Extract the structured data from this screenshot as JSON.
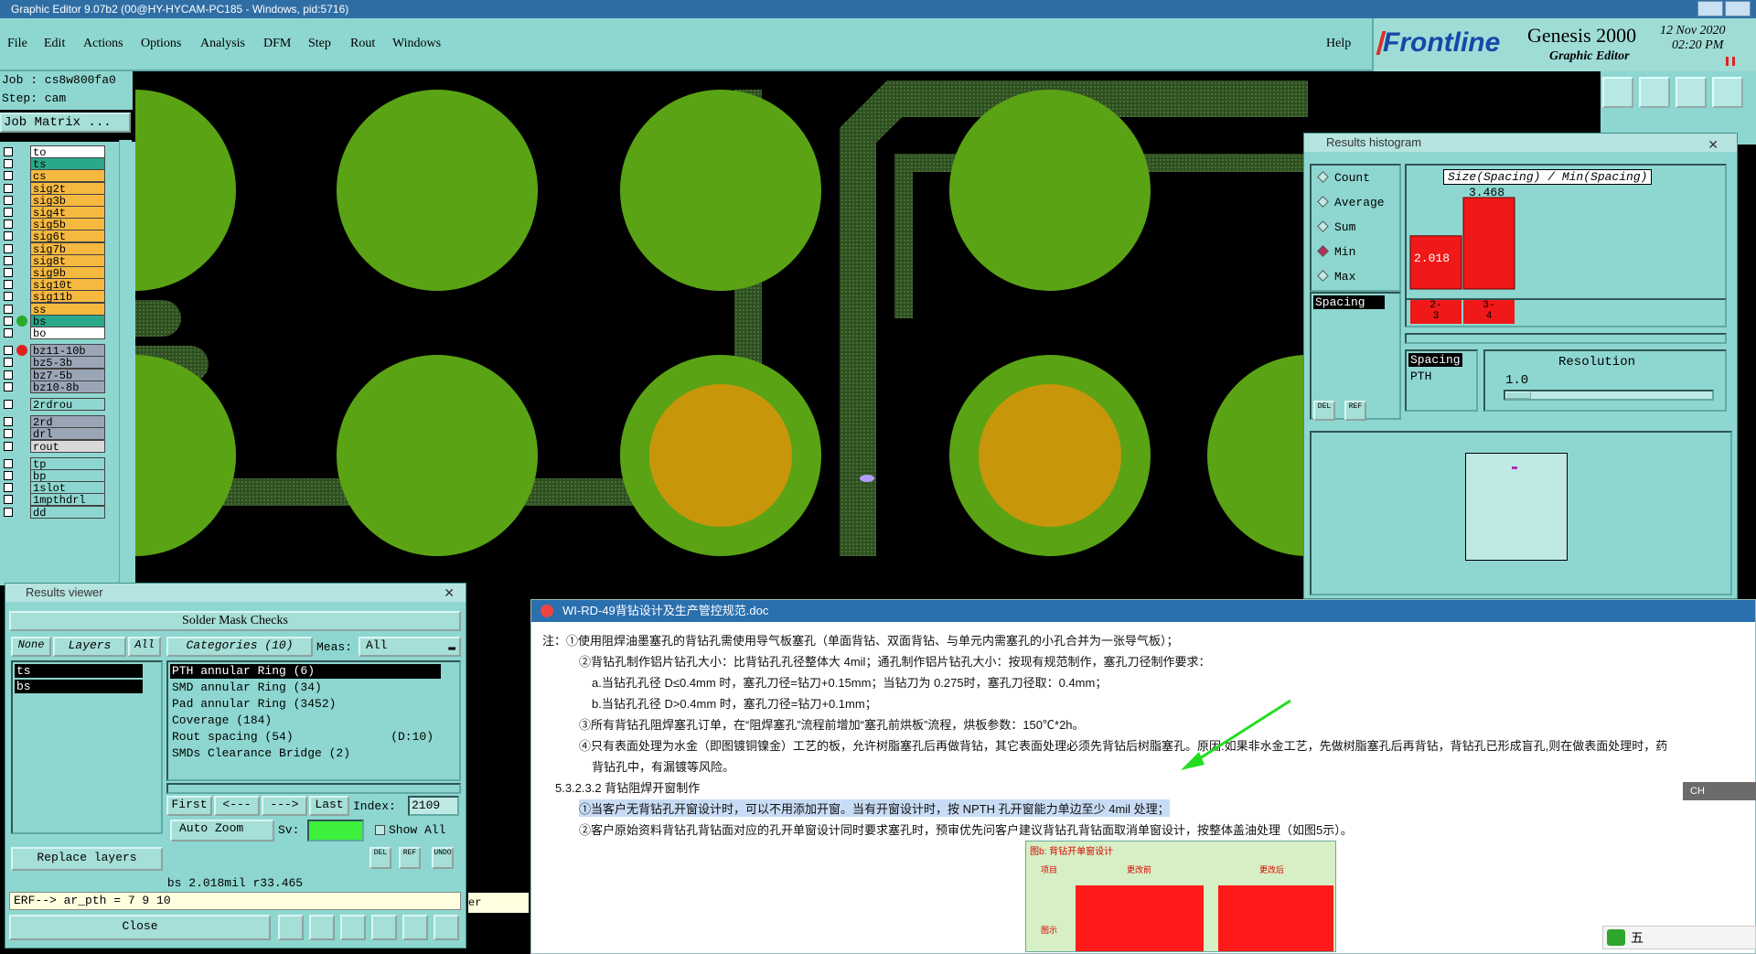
{
  "window": {
    "title": "Graphic Editor 9.07b2 (00@HY-HYCAM-PC185 - Windows, pid:5716)"
  },
  "menu": {
    "items": [
      "File",
      "Edit",
      "Actions",
      "Options",
      "Analysis",
      "DFM",
      "Step",
      "Rout",
      "Windows"
    ],
    "help": "Help"
  },
  "brand": {
    "logo": "Frontline",
    "product": "Genesis 2000",
    "subtitle": "Graphic Editor",
    "date": "12 Nov 2020",
    "time": "02:20 PM"
  },
  "job": {
    "job_line": "Job : cs8w800fa0",
    "step_line": "Step: cam",
    "matrix_button": "Job Matrix ..."
  },
  "layers": [
    {
      "name": "to",
      "color": "#ffffff"
    },
    {
      "name": "ts",
      "color": "#2aa88a"
    },
    {
      "name": "cs",
      "color": "#f6b940"
    },
    {
      "name": "sig2t",
      "color": "#f6b940"
    },
    {
      "name": "sig3b",
      "color": "#f6b940"
    },
    {
      "name": "sig4t",
      "color": "#f6b940"
    },
    {
      "name": "sig5b",
      "color": "#f6b940"
    },
    {
      "name": "sig6t",
      "color": "#f6b940"
    },
    {
      "name": "sig7b",
      "color": "#f6b940"
    },
    {
      "name": "sig8t",
      "color": "#f6b940"
    },
    {
      "name": "sig9b",
      "color": "#f6b940"
    },
    {
      "name": "sig10t",
      "color": "#f6b940"
    },
    {
      "name": "sig11b",
      "color": "#f6b940"
    },
    {
      "name": "ss",
      "color": "#f6b940"
    },
    {
      "name": "bs",
      "color": "#2aa88a"
    },
    {
      "name": "bo",
      "color": "#ffffff"
    },
    {
      "name": "bz11-10b",
      "color": "#9aa6b6"
    },
    {
      "name": "bz5-3b",
      "color": "#9aa6b6"
    },
    {
      "name": "bz7-5b",
      "color": "#9aa6b6"
    },
    {
      "name": "bz10-8b",
      "color": "#9aa6b6"
    },
    {
      "name": "2rdrou",
      "color": "#8ed7d0"
    },
    {
      "name": "2rd",
      "color": "#9aa6b6"
    },
    {
      "name": "drl",
      "color": "#9aa6b6"
    },
    {
      "name": "rout",
      "color": "#d9d9d9"
    },
    {
      "name": "tp",
      "color": "#8ed7d0"
    },
    {
      "name": "bp",
      "color": "#8ed7d0"
    },
    {
      "name": "1slot",
      "color": "#8ed7d0"
    },
    {
      "name": "1mpthdrl",
      "color": "#8ed7d0"
    },
    {
      "name": "dd",
      "color": "#8ed7d0"
    }
  ],
  "histogram": {
    "title": "Results histogram",
    "modes": [
      "Count",
      "Average",
      "Sum",
      "Min",
      "Max"
    ],
    "selected_mode": "Min",
    "measure_list_item": "Spacing",
    "chart_title": "Size(Spacing) / Min(Spacing)",
    "bars": [
      {
        "label": "2-\n3",
        "value": 2.018,
        "value_text": "2.018"
      },
      {
        "label": "3-\n4",
        "value": 3.468,
        "value_text": "3.468"
      }
    ],
    "spacing_label": "Spacing",
    "pth_label": "PTH",
    "resolution_label": "Resolution",
    "resolution_value": "1.0"
  },
  "results_viewer": {
    "title": "Results viewer",
    "heading": "Solder Mask Checks",
    "none_btn": "None",
    "layers_btn": "Layers",
    "all_btn": "All",
    "layer_items": [
      "ts",
      "bs"
    ],
    "categories_label": "Categories (10)",
    "meas_label": "Meas:",
    "meas_value": "All",
    "categories": [
      {
        "text": "PTH annular Ring (6)",
        "extra": ""
      },
      {
        "text": "SMD annular Ring (34)",
        "extra": ""
      },
      {
        "text": "Pad annular Ring (3452)",
        "extra": ""
      },
      {
        "text": "Coverage (184)",
        "extra": ""
      },
      {
        "text": "Rout spacing (54)",
        "extra": "(D:10)"
      },
      {
        "text": "SMDs Clearance Bridge (2)",
        "extra": ""
      }
    ],
    "first_btn": "First",
    "prev_btn": "<---",
    "next_btn": "--->",
    "last_btn": "Last",
    "index_label": "Index:",
    "index_value": "2109",
    "auto_zoom": "Auto Zoom",
    "sv_label": "Sv:",
    "show_all": "Show All",
    "replace_layers": "Replace layers",
    "status_line": "bs 2.018mil  r33.465",
    "erf_line": "ERF--> ar_pth = 7 9 10",
    "close_btn": "Close",
    "side_fragment": "er"
  },
  "document": {
    "title": "WI-RD-49背钻设计及生产管控规范.doc",
    "lines": [
      "注：①使用阻焊油墨塞孔的背钻孔需使用导气板塞孔（单面背钻、双面背钻、与单元内需塞孔的小孔合并为一张导气板）；",
      "②背钻孔制作铝片钻孔大小：比背钻孔孔径整体大 4mil；通孔制作铝片钻孔大小：按现有规范制作，塞孔刀径制作要求：",
      "a.当钻孔孔径 D≤0.4mm 时，塞孔刀径=钻刀+0.15mm；当钻刀为 0.275时，塞孔刀径取：0.4mm；",
      "b.当钻孔孔径 D>0.4mm 时，塞孔刀径=钻刀+0.1mm；",
      "③所有背钻孔阻焊塞孔订单，在“阻焊塞孔”流程前增加“塞孔前烘板”流程，烘板参数：150℃*2h。",
      "④只有表面处理为水金（即图镀铜镍金）工艺的板，允许树脂塞孔后再做背钻，其它表面处理必须先背钻后树脂塞孔。原因:如果非水金工艺，先做树脂塞孔后再背钻，背钻孔已形成盲孔,则在做表面处理时，药",
      "背钻孔中，有漏镀等风险。",
      "5.3.2.3.2 背钻阻焊开窗制作",
      "①当客户无背钻孔开窗设计时，可以不用添加开窗。当有开窗设计时，按 NPTH 孔开窗能力单边至少 4mil 处理；",
      "②客户原始资料背钻孔背钻面对应的孔开单窗设计同时要求塞孔时，预审优先问客户建议背钻孔背钻面取消单窗设计，按整体盖油处理（如图5示）。"
    ],
    "table_header": "图b: 背钻开单窗设计",
    "col_item": "项目",
    "col_before": "更改前",
    "col_after": "更改后",
    "row_label": "图示"
  },
  "taskbar": {
    "ime_label": "五",
    "lang": "CH"
  }
}
